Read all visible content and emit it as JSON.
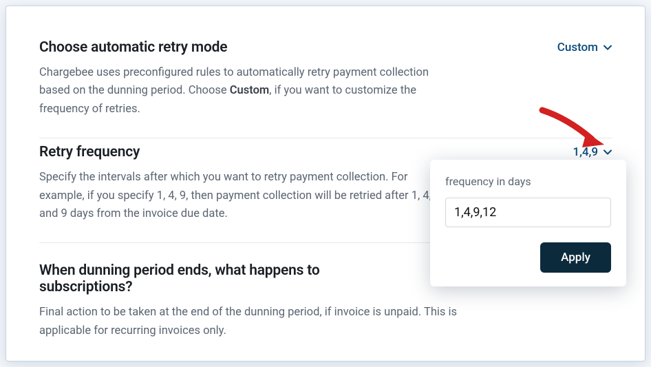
{
  "sections": {
    "retry_mode": {
      "title": "Choose automatic retry mode",
      "description_part1": "Chargebee uses preconfigured rules to automatically retry payment collection based on the dunning period. Choose ",
      "description_bold": "Custom",
      "description_part2": ", if you want to customize the frequency of retries.",
      "value": "Custom"
    },
    "retry_frequency": {
      "title": "Retry frequency",
      "description": "Specify the intervals after which you want to retry payment collection. For example, if you specify 1, 4, 9, then payment collection will be retried after 1, 4, and 9 days from the invoice due date.",
      "value": "1,4,9"
    },
    "dunning_end": {
      "title": "When dunning period ends, what happens to subscriptions?",
      "description": "Final action to be taken at the end of the dunning period, if invoice is unpaid. This is applicable for recurring invoices only."
    }
  },
  "popover": {
    "label": "frequency in days",
    "input_value": "1,4,9,12",
    "apply_label": "Apply"
  }
}
